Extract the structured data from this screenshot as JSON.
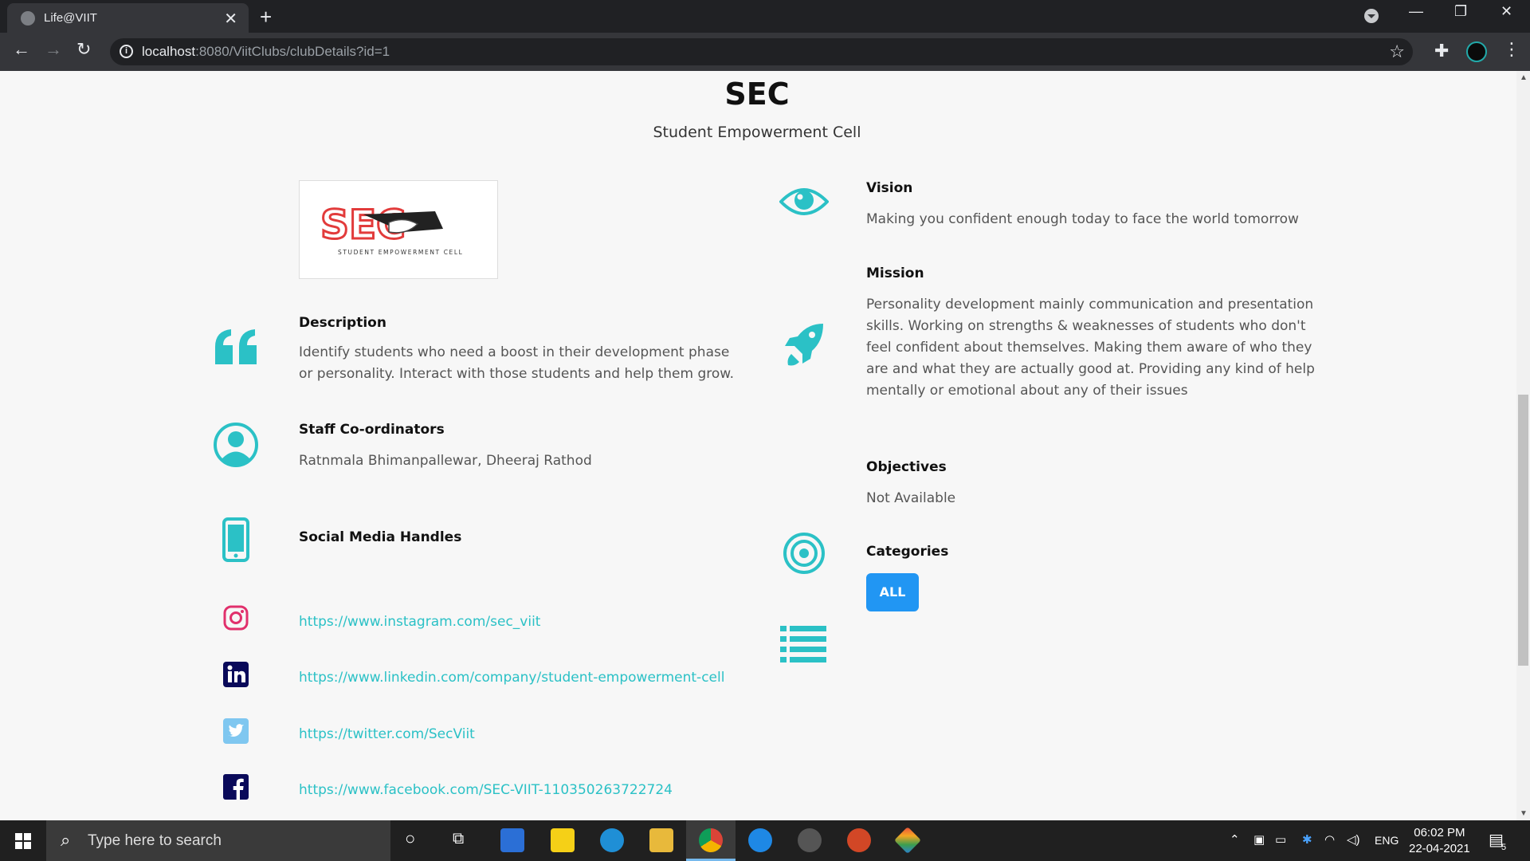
{
  "browser": {
    "tab_title": "Life@VIIT",
    "tab_close": "✕",
    "new_tab": "+",
    "url_host": "localhost",
    "url_rest": ":8080/ViitClubs/clubDetails?id=1",
    "win_min": "—",
    "win_max": "❐",
    "win_close": "✕"
  },
  "club": {
    "short_name": "SEC",
    "full_name": "Student Empowerment Cell",
    "logo_text": "STUDENT EMPOWERMENT CELL"
  },
  "left": {
    "description_heading": "Description",
    "description_text": "Identify students who need a boost in their development phase or personality. Interact with those students and help them grow.",
    "staff_heading": "Staff  Co-ordinators",
    "staff_text": "Ratnmala Bhimanpallewar, Dheeraj Rathod",
    "social_heading": "Social  Media  Handles",
    "instagram": "https://www.instagram.com/sec_viit",
    "linkedin": "https://www.linkedin.com/company/student-empowerment-cell",
    "twitter": "https://twitter.com/SecViit",
    "facebook": "https://www.facebook.com/SEC-VIIT-110350263722724"
  },
  "right": {
    "vision_heading": "Vision",
    "vision_text": "Making you confident enough today to face the world tomorrow",
    "mission_heading": "Mission",
    "mission_text": "Personality development mainly communication and presentation skills. Working on strengths & weaknesses of students who don't feel confident about themselves. Making them aware of who they are and what they are actually good at. Providing any kind of help mentally or emotional about any of their issues",
    "objectives_heading": "Objectives",
    "objectives_text": "Not Available",
    "categories_heading": "Categories",
    "category_button": "ALL"
  },
  "taskbar": {
    "search_placeholder": "Type here to search",
    "lang": "ENG",
    "time": "06:02 PM",
    "date": "22-04-2021",
    "notification_count": "5"
  },
  "colors": {
    "accent": "#2bc1c6",
    "button": "#2196f3"
  }
}
